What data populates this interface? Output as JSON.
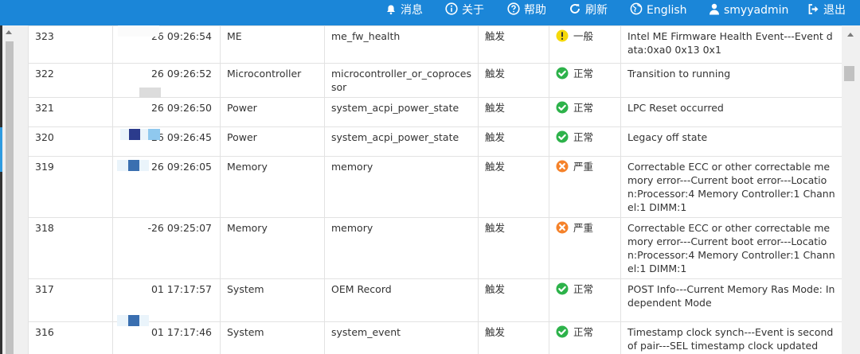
{
  "nav": [
    {
      "icon": "bell-icon",
      "label": "消息"
    },
    {
      "icon": "info-icon",
      "label": "关于"
    },
    {
      "icon": "help-icon",
      "label": "帮助"
    },
    {
      "icon": "refresh-icon",
      "label": "刷新"
    },
    {
      "icon": "globe-icon",
      "label": "English"
    },
    {
      "icon": "user-icon",
      "label": "smyyadmin"
    },
    {
      "icon": "logout-icon",
      "label": "退出"
    }
  ],
  "colors": {
    "nav_bg": "#1b86d8",
    "status_warning": "#f5d90a",
    "status_ok": "#2db24a",
    "status_critical": "#f5822a"
  },
  "rows": [
    {
      "id": "323",
      "time": "26 09:26:54",
      "sensor_type": "ME",
      "sensor": "me_fw_health",
      "event_type": "触发",
      "severity": "warning",
      "severity_label": "一般",
      "description": "Intel ME Firmware Health Event---Event data:0xa0 0x13 0x1"
    },
    {
      "id": "322",
      "time": "26 09:26:52",
      "sensor_type": "Microcontroller",
      "sensor": "microcontroller_or_coprocessor",
      "event_type": "触发",
      "severity": "ok",
      "severity_label": "正常",
      "description": "Transition to running"
    },
    {
      "id": "321",
      "time": "26 09:26:50",
      "sensor_type": "Power",
      "sensor": "system_acpi_power_state",
      "event_type": "触发",
      "severity": "ok",
      "severity_label": "正常",
      "description": "LPC Reset occurred"
    },
    {
      "id": "320",
      "time": "26 09:26:45",
      "sensor_type": "Power",
      "sensor": "system_acpi_power_state",
      "event_type": "触发",
      "severity": "ok",
      "severity_label": "正常",
      "description": "Legacy off state"
    },
    {
      "id": "319",
      "time": "26 09:26:05",
      "sensor_type": "Memory",
      "sensor": "memory",
      "event_type": "触发",
      "severity": "critical",
      "severity_label": "严重",
      "description": "Correctable ECC or other correctable memory error---Current boot error---Location:Processor:4 Memory Controller:1 Channel:1 DIMM:1"
    },
    {
      "id": "318",
      "time": "-26 09:25:07",
      "sensor_type": "Memory",
      "sensor": "memory",
      "event_type": "触发",
      "severity": "critical",
      "severity_label": "严重",
      "description": "Correctable ECC or other correctable memory error---Current boot error---Location:Processor:4 Memory Controller:1 Channel:1 DIMM:1"
    },
    {
      "id": "317",
      "time": "01 17:17:57",
      "sensor_type": "System",
      "sensor": "OEM Record",
      "event_type": "触发",
      "severity": "ok",
      "severity_label": "正常",
      "description": "POST Info---Current Memory Ras Mode: Independent Mode"
    },
    {
      "id": "316",
      "time": "01 17:17:46",
      "sensor_type": "System",
      "sensor": "system_event",
      "event_type": "触发",
      "severity": "ok",
      "severity_label": "正常",
      "description": "Timestamp clock synch---Event is second of pair---SEL timestamp clock updated"
    }
  ]
}
